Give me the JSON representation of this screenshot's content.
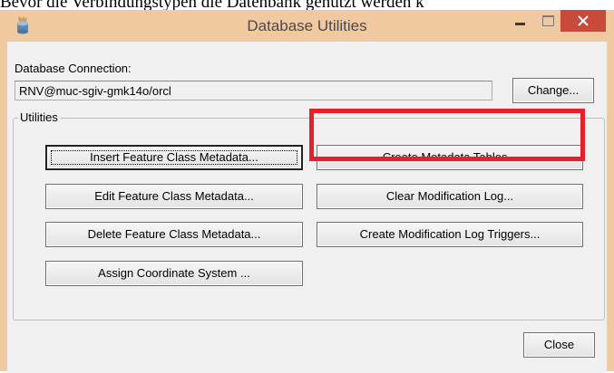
{
  "background_text": "Bevor die Verbindungstypen die Datenbank genutzt werden k",
  "window": {
    "title": "Database Utilities",
    "titlebar_color": "#f1c9a0",
    "close_button_color": "#c84a3a"
  },
  "connection": {
    "label": "Database Connection:",
    "value": "RNV@muc-sgiv-gmk14o/orcl",
    "change_button": "Change..."
  },
  "utilities": {
    "group_label": "Utilities",
    "left_buttons": [
      "Insert Feature Class Metadata...",
      "Edit Feature Class Metadata...",
      "Delete Feature Class Metadata...",
      "Assign Coordinate System ..."
    ],
    "right_buttons": [
      "Create Metadata Tables...",
      "Clear Modification Log...",
      "Create Modification Log Triggers..."
    ],
    "highlight_color": "#e8202a"
  },
  "footer": {
    "close_button": "Close"
  }
}
